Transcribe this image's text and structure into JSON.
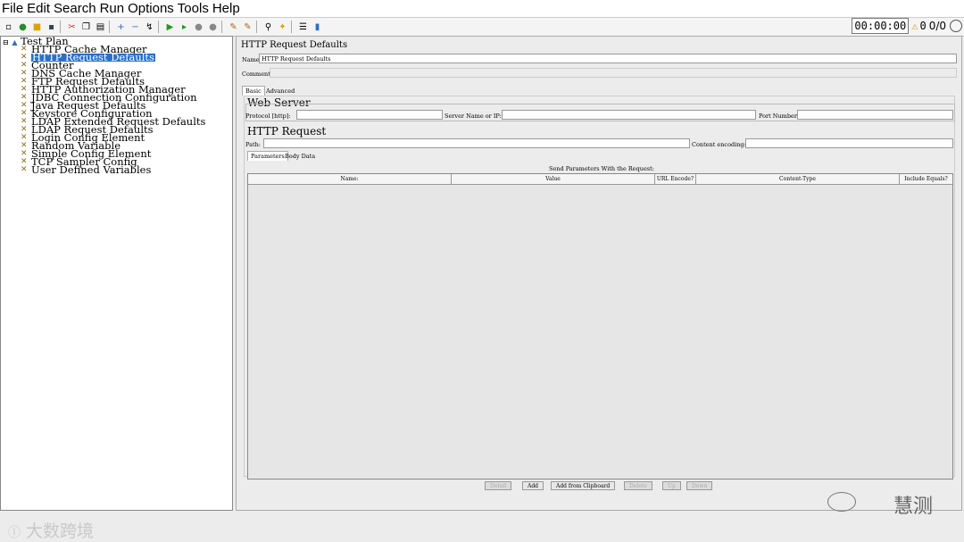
{
  "menu": [
    "File",
    "Edit",
    "Search",
    "Run",
    "Options",
    "Tools",
    "Help"
  ],
  "status": {
    "timer": "00:00:00",
    "warnings": "0",
    "counts": "0/0"
  },
  "tree": {
    "root": "Test Plan",
    "items": [
      "HTTP Cache Manager",
      "HTTP Request Defaults",
      "Counter",
      "DNS Cache Manager",
      "FTP Request Defaults",
      "HTTP Authorization Manager",
      "JDBC Connection Configuration",
      "Java Request Defaults",
      "Keystore Configuration",
      "LDAP Extended Request Defaults",
      "LDAP Request Defaults",
      "Login Config Element",
      "Random Variable",
      "Simple Config Element",
      "TCP Sampler Config",
      "User Defined Variables"
    ],
    "selected_index": 1
  },
  "panel": {
    "title": "HTTP Request Defaults",
    "name_label": "Name:",
    "name_value": "HTTP Request Defaults",
    "comments_label": "Comments:",
    "tabs": [
      "Basic",
      "Advanced"
    ],
    "web_server": {
      "title": "Web Server",
      "protocol_label": "Protocol [http]:",
      "server_label": "Server Name or IP:",
      "port_label": "Port Number:"
    },
    "http_request": {
      "title": "HTTP Request",
      "path_label": "Path:",
      "encoding_label": "Content encoding:"
    },
    "sub_tabs": [
      "Parameters",
      "Body Data"
    ],
    "params_caption": "Send Parameters With the Request:",
    "columns": [
      "Name:",
      "Value",
      "URL Encode?",
      "Content-Type",
      "Include Equals?"
    ],
    "buttons": [
      "Detail",
      "Add",
      "Add from Clipboard",
      "Delete",
      "Up",
      "Down"
    ]
  },
  "watermarks": {
    "left": "大数跨境",
    "right": "慧测"
  }
}
